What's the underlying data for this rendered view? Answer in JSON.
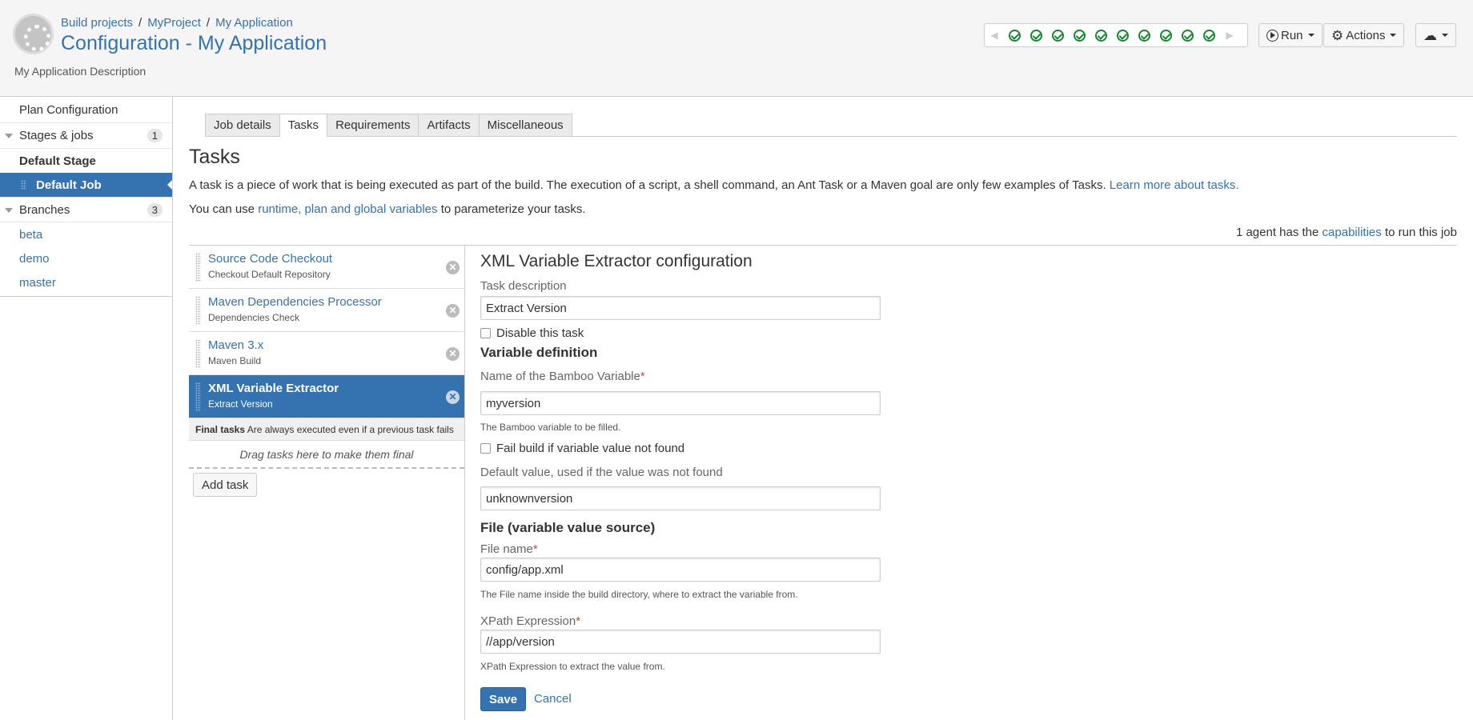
{
  "header": {
    "breadcrumb": [
      "Build projects",
      "MyProject",
      "My Application"
    ],
    "title": "Configuration - My Application",
    "description": "My Application Description",
    "build_status": {
      "statuses": [
        "success",
        "success",
        "success",
        "success",
        "success",
        "success",
        "success",
        "success",
        "success",
        "success"
      ],
      "success_color": "#14892c"
    },
    "run_label": "Run",
    "actions_label": "Actions"
  },
  "sidebar": {
    "plan_configuration": "Plan Configuration",
    "stages_label": "Stages & jobs",
    "stages_count": "1",
    "stage_name": "Default Stage",
    "job_name": "Default Job",
    "branches_label": "Branches",
    "branches_count": "3",
    "branches": [
      "beta",
      "demo",
      "master"
    ]
  },
  "main": {
    "tabs": [
      "Job details",
      "Tasks",
      "Requirements",
      "Artifacts",
      "Miscellaneous"
    ],
    "active_tab": "Tasks",
    "heading": "Tasks",
    "intro_text": "A task is a piece of work that is being executed as part of the build. The execution of a script, a shell command, an Ant Task or a Maven goal are only few examples of Tasks.",
    "intro_link": "Learn more about tasks.",
    "vars_prefix": "You can use",
    "vars_link": "runtime, plan and global variables",
    "vars_suffix": "to parameterize your tasks.",
    "agent_prefix": "1 agent has the",
    "agent_link": "capabilities",
    "agent_suffix": "to run this job"
  },
  "tasks": [
    {
      "name": "Source Code Checkout",
      "description": "Checkout Default Repository"
    },
    {
      "name": "Maven Dependencies Processor",
      "description": "Dependencies Check"
    },
    {
      "name": "Maven 3.x",
      "description": "Maven Build"
    },
    {
      "name": "XML Variable Extractor",
      "description": "Extract Version"
    }
  ],
  "final_tasks": {
    "label": "Final tasks",
    "note": "Are always executed even if a previous task fails",
    "drop_hint": "Drag tasks here to make them final"
  },
  "add_task_label": "Add task",
  "config": {
    "title": "XML Variable Extractor configuration",
    "task_description_label": "Task description",
    "task_description_value": "Extract Version",
    "disable_label": "Disable this task",
    "variable_section": "Variable definition",
    "variable_name_label": "Name of the Bamboo Variable",
    "variable_name_value": "myversion",
    "variable_name_hint": "The Bamboo variable to be filled.",
    "fail_build_label": "Fail build if variable value not found",
    "default_value_label": "Default value, used if the value was not found",
    "default_value_value": "unknownversion",
    "file_section": "File (variable value source)",
    "file_name_label": "File name",
    "file_name_value": "config/app.xml",
    "file_name_hint": "The File name inside the build directory, where to extract the variable from.",
    "xpath_label": "XPath Expression",
    "xpath_value": "//app/version",
    "xpath_hint": "XPath Expression to extract the value from.",
    "required_mark": "*",
    "save_label": "Save",
    "cancel_label": "Cancel"
  },
  "colors": {
    "accent": "#3572b0",
    "required": "#d04437"
  }
}
